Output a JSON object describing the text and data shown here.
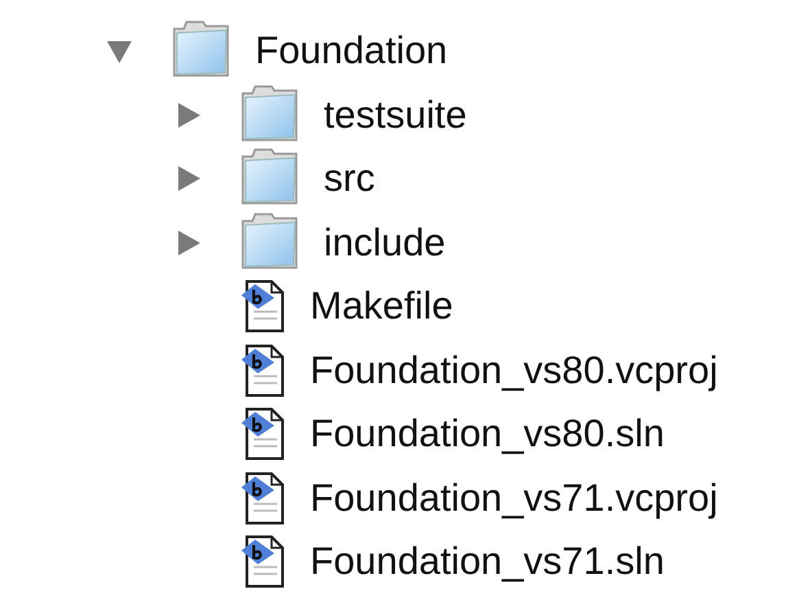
{
  "tree": [
    {
      "kind": "folder",
      "name": "Foundation",
      "expanded": true,
      "children": [
        {
          "kind": "folder",
          "name": "testsuite",
          "expanded": false
        },
        {
          "kind": "folder",
          "name": "src",
          "expanded": false
        },
        {
          "kind": "folder",
          "name": "include",
          "expanded": false
        },
        {
          "kind": "file",
          "name": "Makefile"
        },
        {
          "kind": "file",
          "name": "Foundation_vs80.vcproj"
        },
        {
          "kind": "file",
          "name": "Foundation_vs80.sln"
        },
        {
          "kind": "file",
          "name": "Foundation_vs71.vcproj"
        },
        {
          "kind": "file",
          "name": "Foundation_vs71.sln"
        }
      ]
    }
  ]
}
